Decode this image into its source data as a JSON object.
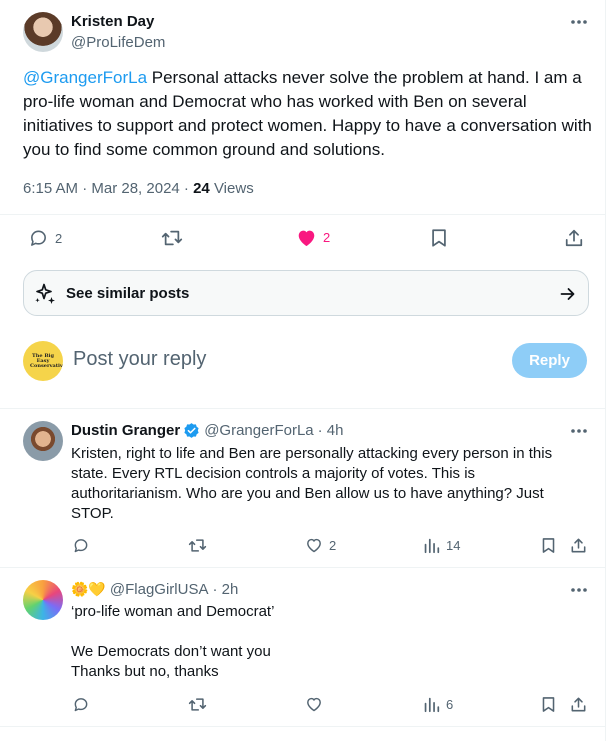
{
  "main_post": {
    "author_name": "Kristen Day",
    "author_handle": "@ProLifeDem",
    "mention": "@GrangerForLa",
    "body": " Personal attacks never solve the problem at hand. I am a pro-life woman and Democrat who has worked with Ben on several initiatives to support and protect women. Happy to have a conversation with you to find some common ground and solutions.",
    "timestamp": "6:15 AM · Mar 28, 2024 · ",
    "views_count": "24",
    "views_label": " Views",
    "replies": "2",
    "likes": "2",
    "colors": {
      "like": "#f91880",
      "accent": "#1d9bf0"
    }
  },
  "similar_posts": {
    "label": "See similar posts"
  },
  "reply_box": {
    "placeholder": "Post your reply",
    "button": "Reply",
    "avatar_text": "The Big Easy Conservative"
  },
  "replies": [
    {
      "name": "Dustin Granger",
      "handle": "@GrangerForLa",
      "time": "· 4h",
      "lines": [
        "Kristen, right to life and Ben are personally attacking every person in this",
        "state. Every RTL decision controls a majority of votes. This is",
        "authoritarianism. Who are you and Ben allow us to have anything? Just",
        "STOP."
      ],
      "likes": "2",
      "views": "14"
    },
    {
      "name_emoji": "🌼💛",
      "handle": "@FlagGirlUSA",
      "time": "· 2h",
      "lines": [
        "‘pro-life woman and Democrat’",
        "",
        "We Democrats don’t want you",
        "Thanks but no, thanks"
      ],
      "views": "6"
    }
  ]
}
